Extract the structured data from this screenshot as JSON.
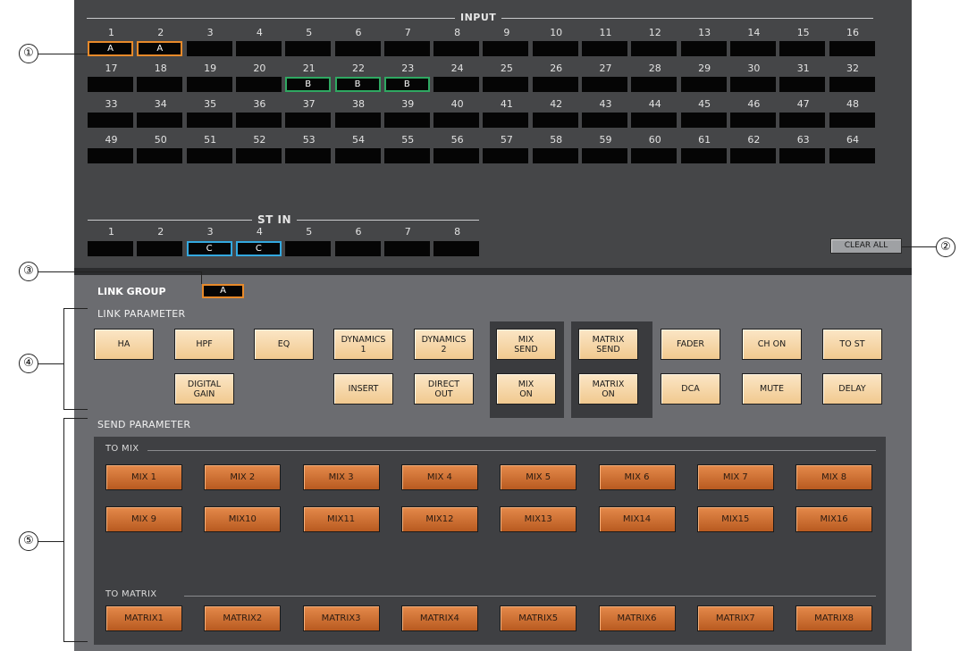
{
  "input": {
    "title": "INPUT",
    "channels": [
      "1",
      "2",
      "3",
      "4",
      "5",
      "6",
      "7",
      "8",
      "9",
      "10",
      "11",
      "12",
      "13",
      "14",
      "15",
      "16",
      "17",
      "18",
      "19",
      "20",
      "21",
      "22",
      "23",
      "24",
      "25",
      "26",
      "27",
      "28",
      "29",
      "30",
      "31",
      "32",
      "33",
      "34",
      "35",
      "36",
      "37",
      "38",
      "39",
      "40",
      "41",
      "42",
      "43",
      "44",
      "45",
      "46",
      "47",
      "48",
      "49",
      "50",
      "51",
      "52",
      "53",
      "54",
      "55",
      "56",
      "57",
      "58",
      "59",
      "60",
      "61",
      "62",
      "63",
      "64"
    ],
    "assigned": {
      "1": "A",
      "2": "A",
      "21": "B",
      "22": "B",
      "23": "B"
    }
  },
  "st_in": {
    "title": "ST IN",
    "channels": [
      "1",
      "2",
      "3",
      "4",
      "5",
      "6",
      "7",
      "8"
    ],
    "assigned": {
      "3": "C",
      "4": "C"
    }
  },
  "clear_all_label": "CLEAR ALL",
  "link_group": {
    "label": "LINK GROUP",
    "value": "A"
  },
  "link_parameter": {
    "label": "LINK PARAMETER",
    "row1": [
      "HA",
      "HPF",
      "EQ",
      "DYNAMICS\n1",
      "DYNAMICS\n2",
      "MIX\nSEND",
      "MATRIX\nSEND",
      "FADER",
      "CH ON",
      "TO ST"
    ],
    "row2": [
      "DIGITAL\nGAIN",
      "INSERT",
      "DIRECT\nOUT",
      "MIX\nON",
      "MATRIX\nON",
      "DCA",
      "MUTE",
      "DELAY"
    ]
  },
  "send_parameter": {
    "label": "SEND PARAMETER",
    "to_mix_label": "TO MIX",
    "mix": [
      "MIX 1",
      "MIX 2",
      "MIX 3",
      "MIX 4",
      "MIX 5",
      "MIX 6",
      "MIX 7",
      "MIX 8",
      "MIX 9",
      "MIX10",
      "MIX11",
      "MIX12",
      "MIX13",
      "MIX14",
      "MIX15",
      "MIX16"
    ],
    "to_matrix_label": "TO MATRIX",
    "matrix": [
      "MATRIX1",
      "MATRIX2",
      "MATRIX3",
      "MATRIX4",
      "MATRIX5",
      "MATRIX6",
      "MATRIX7",
      "MATRIX8"
    ]
  },
  "callouts": [
    "①",
    "②",
    "③",
    "④",
    "⑤"
  ],
  "colors": {
    "group_a": "#e88a2a",
    "group_b": "#2fa862",
    "group_c": "#33a9e0",
    "link_button": "#f1c98f",
    "send_button": "#c96a2c"
  }
}
